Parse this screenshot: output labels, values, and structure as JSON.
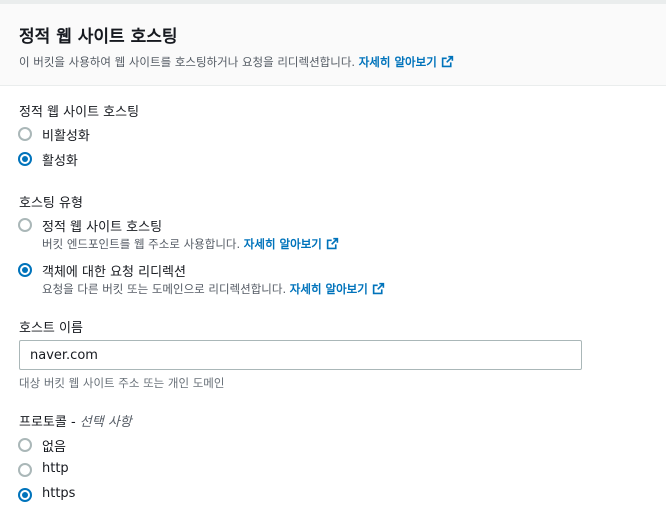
{
  "header": {
    "title": "정적 웹 사이트 호스팅",
    "description": "이 버킷을 사용하여 웹 사이트를 호스팅하거나 요청을 리디렉션합니다.",
    "learn_more": "자세히 알아보기"
  },
  "hosting_toggle": {
    "label": "정적 웹 사이트 호스팅",
    "options": [
      {
        "label": "비활성화",
        "selected": false
      },
      {
        "label": "활성화",
        "selected": true
      }
    ]
  },
  "hosting_type": {
    "label": "호스팅 유형",
    "options": [
      {
        "label": "정적 웹 사이트 호스팅",
        "description": "버킷 엔드포인트를 웹 주소로 사용합니다.",
        "learn_more": "자세히 알아보기",
        "selected": false
      },
      {
        "label": "객체에 대한 요청 리디렉션",
        "description": "요청을 다른 버킷 또는 도메인으로 리디렉션합니다.",
        "learn_more": "자세히 알아보기",
        "selected": true
      }
    ]
  },
  "host_name": {
    "label": "호스트 이름",
    "value": "naver.com",
    "hint": "대상 버킷 웹 사이트 주소 또는 개인 도메인"
  },
  "protocol": {
    "label": "프로토콜 - ",
    "optional": "선택 사항",
    "options": [
      {
        "label": "없음",
        "selected": false
      },
      {
        "label": "http",
        "selected": false
      },
      {
        "label": "https",
        "selected": true
      }
    ]
  },
  "icons": {
    "external_link": "external-link-icon"
  },
  "colors": {
    "accent": "#0073bb",
    "text": "#16191f",
    "secondary_text": "#545b64",
    "header_bg": "#fafafa"
  }
}
